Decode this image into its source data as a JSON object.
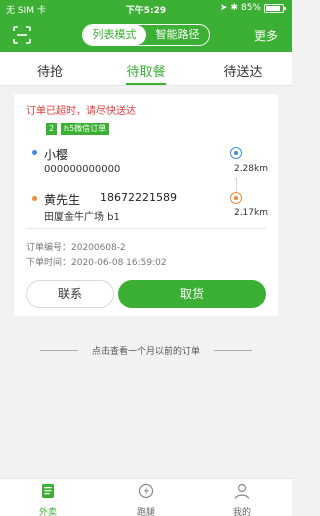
{
  "status_bar": {
    "carrier": "无 SIM 卡",
    "time": "下午5:29",
    "battery": "85%"
  },
  "navbar": {
    "segments": [
      "列表模式",
      "智能路径"
    ],
    "active_segment": "列表模式",
    "more_label": "更多"
  },
  "tabs": [
    {
      "label": "待抢"
    },
    {
      "label": "待取餐"
    },
    {
      "label": "待送达"
    }
  ],
  "active_tab": "待取餐",
  "order": {
    "warning": "订单已超时，请尽快送达",
    "tag_number": "2",
    "tag_source": "h5微信订单",
    "pickup": {
      "name": "小樱",
      "phone": "000000000000",
      "distance": "2.28km"
    },
    "delivery": {
      "name": "黄先生",
      "phone": "18672221589",
      "address": "田厦金牛广场 b1",
      "distance": "2.17km"
    },
    "order_number_label": "订单编号：20200608-2",
    "order_time_label": "下单时间：2020-06-08 16:59:02",
    "contact_label": "联系",
    "pickup_label": "取货"
  },
  "history_link": "点击查看一个月以前的订单",
  "bottom_nav": [
    {
      "label": "外卖",
      "icon": "takeout-icon"
    },
    {
      "label": "跑腿",
      "icon": "errand-icon"
    },
    {
      "label": "我的",
      "icon": "profile-icon"
    }
  ],
  "colors": {
    "brand_green": "#3cb034",
    "warning_red": "#e23b3b",
    "pin_blue": "#3a8ee6",
    "pin_orange": "#f08a3c"
  }
}
